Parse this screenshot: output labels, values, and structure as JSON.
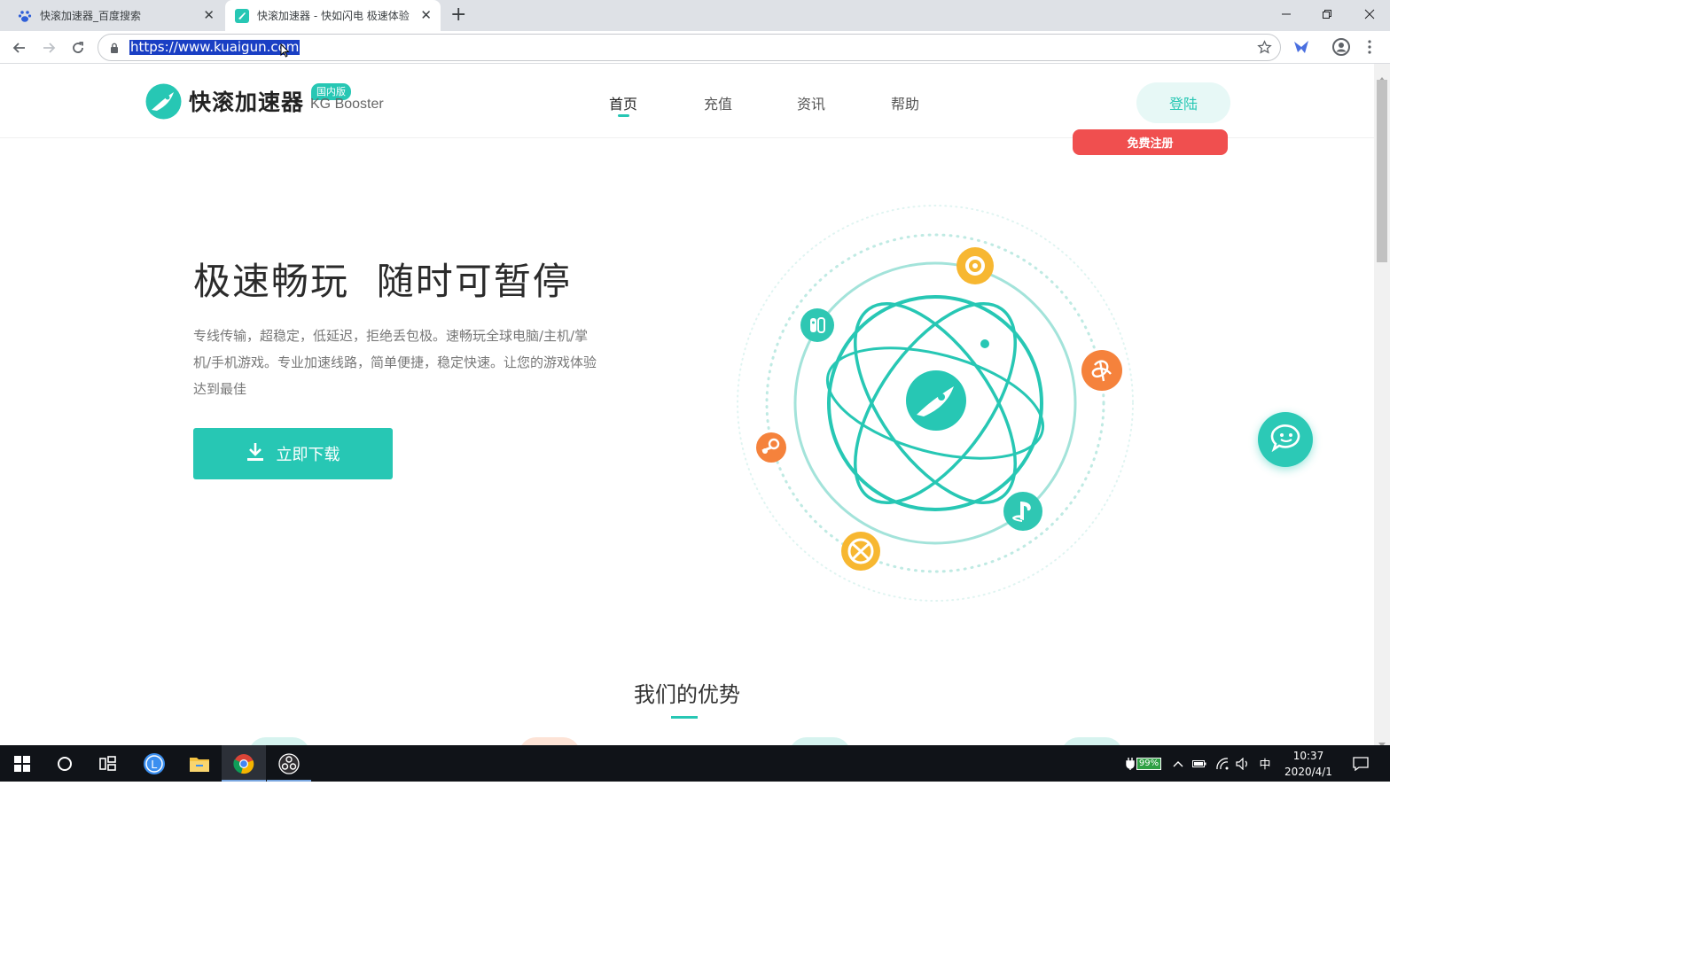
{
  "browser": {
    "tabs": [
      {
        "title": "快滚加速器_百度搜索",
        "favicon": "baidu-paw-icon"
      },
      {
        "title": "快滚加速器 - 快如闪电 极速体验",
        "favicon": "kuaigun-logo-icon",
        "active": true
      }
    ],
    "new_tab": "+",
    "address": "https://www.kuaigun.com"
  },
  "site": {
    "brand": {
      "name": "快滚加速器",
      "badge": "国内版",
      "english": "KG Booster"
    },
    "nav": [
      {
        "label": "首页",
        "active": true
      },
      {
        "label": "充值",
        "active": false
      },
      {
        "label": "资讯",
        "active": false
      },
      {
        "label": "帮助",
        "active": false
      }
    ],
    "login": "登陆",
    "register": "免费注册",
    "hero": {
      "title": "极速畅玩  随时可暂停",
      "description": "专线传输，超稳定，低延迟，拒绝丢包极。速畅玩全球电脑/主机/掌机/手机游戏。专业加速线路，简单便捷，稳定快速。让您的游戏体验达到最佳",
      "download": "立即下载"
    },
    "advantages_title": "我们的优势"
  },
  "orbit_icons": [
    "origin-icon",
    "switch-icon",
    "battlenet-icon",
    "steam-icon",
    "playstation-icon",
    "xbox-icon",
    "rocket-icon"
  ],
  "taskbar": {
    "battery": "99%",
    "ime": "中",
    "time": "10:37",
    "date": "2020/4/1"
  },
  "colors": {
    "accent": "#27c7b4",
    "register": "#f04f4f",
    "orange": "#f7a23b"
  }
}
